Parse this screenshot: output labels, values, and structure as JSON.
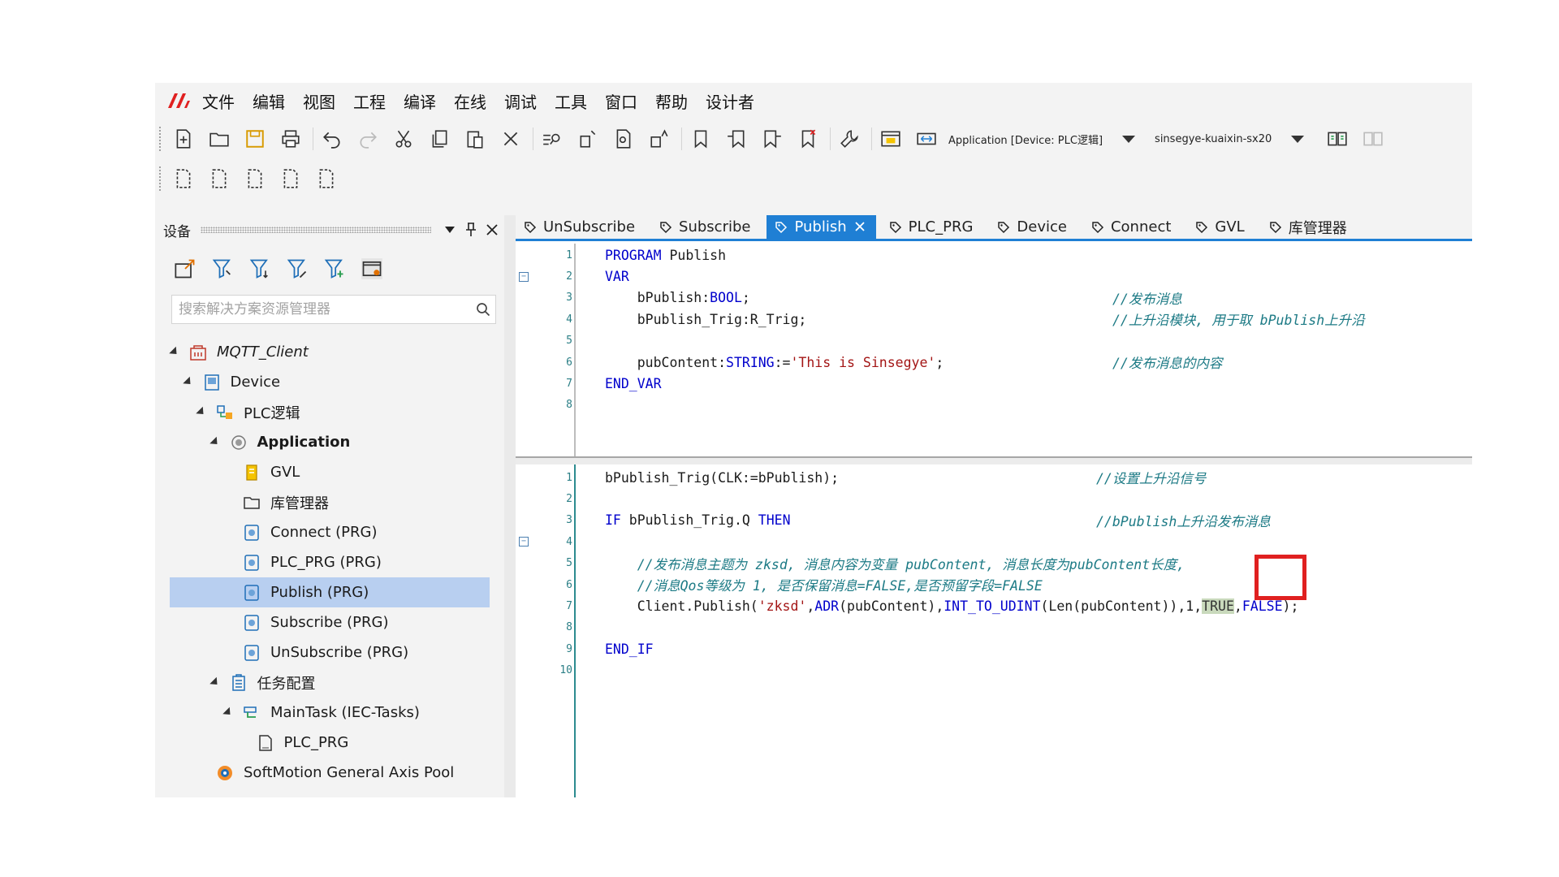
{
  "menu": [
    "文件",
    "编辑",
    "视图",
    "工程",
    "编译",
    "在线",
    "调试",
    "工具",
    "窗口",
    "帮助",
    "设计者"
  ],
  "toolbar": {
    "icons": [
      "new-file-icon",
      "open-folder-icon",
      "save-icon",
      "print-icon",
      "undo-icon",
      "redo-icon",
      "cut-icon",
      "copy-icon",
      "paste-icon",
      "delete-icon",
      "find-icon",
      "find-replace-icon",
      "find-in-files-icon",
      "replace-icon",
      "bookmark-icon",
      "prev-bookmark-icon",
      "next-bookmark-icon",
      "clear-bookmark-icon",
      "wrench-icon",
      "browser-icon",
      "resize-icon"
    ],
    "application_combo": "Application [Device: PLC逻辑]",
    "device_combo": "sinsegye-kuaixin-sx20"
  },
  "toolbar2": {
    "icons": [
      "page-icon-1",
      "page-icon-2",
      "page-icon-3",
      "page-icon-4",
      "page-icon-5"
    ]
  },
  "device_panel": {
    "title": "设备",
    "search_placeholder": "搜索解决方案资源管理器",
    "tree": [
      {
        "label": "MQTT_Client",
        "depth": 0,
        "expand": true,
        "icon": "project-icon",
        "style": "italic"
      },
      {
        "label": "Device",
        "depth": 1,
        "expand": true,
        "icon": "device-icon"
      },
      {
        "label": "PLC逻辑",
        "depth": 2,
        "expand": true,
        "icon": "plc-logic-icon"
      },
      {
        "label": "Application",
        "depth": 3,
        "expand": true,
        "icon": "application-icon",
        "style": "bold"
      },
      {
        "label": "GVL",
        "depth": 4,
        "expand": false,
        "icon": "gvl-icon"
      },
      {
        "label": "库管理器",
        "depth": 4,
        "expand": false,
        "icon": "library-manager-icon"
      },
      {
        "label": "Connect (PRG)",
        "depth": 4,
        "expand": false,
        "icon": "program-icon"
      },
      {
        "label": "PLC_PRG (PRG)",
        "depth": 4,
        "expand": false,
        "icon": "program-icon"
      },
      {
        "label": "Publish (PRG)",
        "depth": 4,
        "expand": false,
        "icon": "program-icon",
        "selected": true
      },
      {
        "label": "Subscribe (PRG)",
        "depth": 4,
        "expand": false,
        "icon": "program-icon"
      },
      {
        "label": "UnSubscribe (PRG)",
        "depth": 4,
        "expand": false,
        "icon": "program-icon"
      },
      {
        "label": "任务配置",
        "depth": 3,
        "expand": true,
        "icon": "task-config-icon"
      },
      {
        "label": "MainTask (IEC-Tasks)",
        "depth": 4,
        "expand": true,
        "icon": "task-icon"
      },
      {
        "label": "PLC_PRG",
        "depth": 5,
        "expand": false,
        "icon": "program-call-icon"
      },
      {
        "label": "SoftMotion General Axis Pool",
        "depth": 2,
        "expand": false,
        "icon": "axis-pool-icon"
      }
    ]
  },
  "editor": {
    "tabs": [
      {
        "label": "UnSubscribe",
        "active": false
      },
      {
        "label": "Subscribe",
        "active": false
      },
      {
        "label": "Publish",
        "active": true
      },
      {
        "label": "PLC_PRG",
        "active": false
      },
      {
        "label": "Device",
        "active": false
      },
      {
        "label": "Connect",
        "active": false
      },
      {
        "label": "GVL",
        "active": false
      },
      {
        "label": "库管理器",
        "active": false
      }
    ],
    "declaration": [
      {
        "num": "1",
        "code": "PROGRAM Publish",
        "comment": ""
      },
      {
        "num": "2",
        "code": "VAR",
        "comment": "",
        "fold": true
      },
      {
        "num": "3",
        "code": "    bPublish:BOOL;",
        "comment": "//发布消息"
      },
      {
        "num": "4",
        "code": "    bPublish_Trig:R_Trig;",
        "comment": "//上升沿模块, 用于取 bPublish上升沿"
      },
      {
        "num": "5",
        "code": "",
        "comment": ""
      },
      {
        "num": "6",
        "code": "    pubContent:STRING:='This is Sinsegye';",
        "comment": "//发布消息的内容"
      },
      {
        "num": "7",
        "code": "END_VAR",
        "comment": ""
      },
      {
        "num": "8",
        "code": "",
        "comment": ""
      }
    ],
    "implementation": [
      {
        "num": "1",
        "code": "bPublish_Trig(CLK:=bPublish);",
        "comment": "//设置上升沿信号"
      },
      {
        "num": "2",
        "code": "",
        "comment": ""
      },
      {
        "num": "3",
        "code": "IF bPublish_Trig.Q THEN",
        "comment": "//bPublish上升沿发布消息"
      },
      {
        "num": "4",
        "code": "",
        "comment": "",
        "fold": true
      },
      {
        "num": "5",
        "code": "    //发布消息主题为 zksd, 消息内容为变量 pubContent, 消息长度为pubContent长度,",
        "comment": ""
      },
      {
        "num": "6",
        "code": "    //消息Qos等级为 1, 是否保留消息=FALSE,是否预留字段=FALSE",
        "comment": ""
      },
      {
        "num": "7",
        "code": "    Client.Publish('zksd',ADR(pubContent),INT_TO_UDINT(Len(pubContent)),1,TRUE,FALSE);",
        "comment": ""
      },
      {
        "num": "8",
        "code": "",
        "comment": ""
      },
      {
        "num": "9",
        "code": "END_IF",
        "comment": ""
      },
      {
        "num": "10",
        "code": "",
        "comment": ""
      }
    ]
  },
  "colors": {
    "accent": "#1f7fd4",
    "selection": "#b8cff0",
    "highlight_box": "#e02020",
    "comment": "#1c7a85",
    "keyword": "#0000cc"
  }
}
